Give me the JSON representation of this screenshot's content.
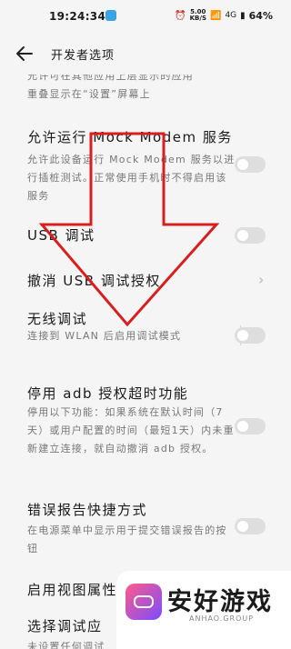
{
  "status_bar": {
    "time": "19:24:34",
    "net_speed_value": "5.00",
    "net_speed_unit": "KB/S",
    "signal": "4G",
    "battery": "64%"
  },
  "header": {
    "title": "开发者选项"
  },
  "items": [
    {
      "id": "overlay",
      "subtitle": "允许可在其他应用上层显示的应用\n重叠显示在“设置”屏幕上"
    },
    {
      "id": "mock-modem",
      "title": "允许运行 Mock Modem 服务",
      "subtitle": "允许此设备运行 Mock Modem 服务以进行插桩测试。正常使用手机时不得启用该服务",
      "toggle": false
    },
    {
      "id": "usb-debug",
      "title": "USB 调试",
      "toggle": false
    },
    {
      "id": "revoke-usb",
      "title": "撤消 USB 调试授权"
    },
    {
      "id": "wireless-debug",
      "title": "无线调试",
      "subtitle": "连接到 WLAN 后启用调试模式",
      "toggle": false
    },
    {
      "id": "adb-timeout",
      "title": "停用 adb 授权超时功能",
      "subtitle": "停用以下功能：如果系统在默认时间（7天）或用户配置的时间（最短1天）内未重新建立连接，就自动撤消 adb 授权。",
      "toggle": false
    },
    {
      "id": "bug-report",
      "title": "错误报告快捷方式",
      "subtitle": "在电源菜单中显示用于提交错误报告的按钮",
      "toggle": false
    },
    {
      "id": "view-attr",
      "title": "启用视图属性检查功能",
      "toggle": false
    },
    {
      "id": "debug-app",
      "title": "选择调试应",
      "subtitle": "未设置任何调试"
    }
  ],
  "watermark": {
    "name": "安好游戏",
    "url": "ANHAO.GROUP"
  },
  "colors": {
    "background": "#f5f5f5",
    "arrow": "#d81e1e",
    "toggle_off": "#dedede"
  }
}
